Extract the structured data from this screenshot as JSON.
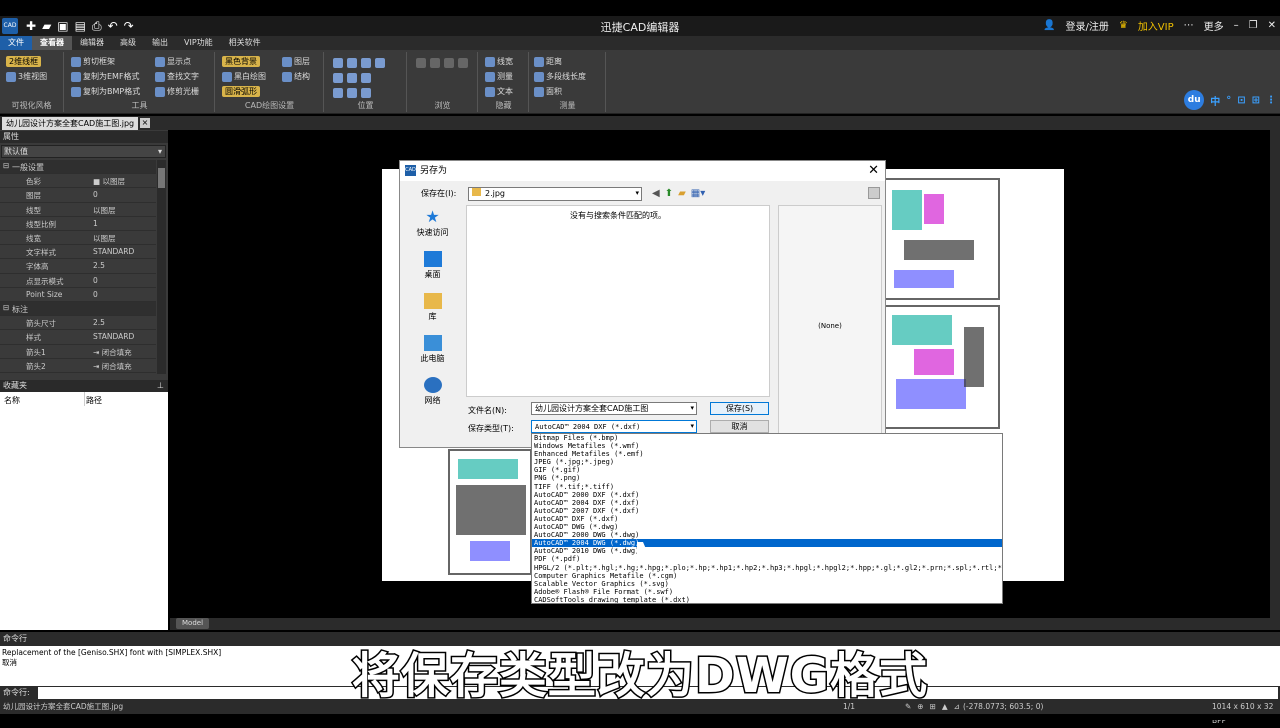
{
  "window": {
    "title": "迅捷CAD编辑器",
    "login": "登录/注册",
    "vip": "加入VIP",
    "more": "更多",
    "logo": "CAD"
  },
  "menu": [
    "文件",
    "查看器",
    "编辑器",
    "高级",
    "输出",
    "VIP功能",
    "相关软件"
  ],
  "ribbon": {
    "visual_style": {
      "label": "可视化风格",
      "items": [
        "2维线框",
        "3维视图"
      ]
    },
    "tools": {
      "label": "工具",
      "items": [
        "剪切框架",
        "复制为EMF格式",
        "复制为BMP格式",
        "显示点",
        "查找文字",
        "修剪光栅"
      ]
    },
    "cad_settings": {
      "label": "CAD绘图设置",
      "items": [
        "黑色背景",
        "黑白绘图",
        "圆滑弧形",
        "图层",
        "结构"
      ]
    },
    "position": {
      "label": "位置"
    },
    "browse": {
      "label": "浏览"
    },
    "hide": {
      "label": "隐藏",
      "items": [
        "线宽",
        "测量",
        "文本"
      ]
    },
    "measure": {
      "label": "测量",
      "items": [
        "距离",
        "多段线长度",
        "面积"
      ]
    },
    "du_icons": [
      "du",
      "中",
      "°",
      "⊡",
      "⊞",
      "⋮"
    ]
  },
  "doc_tab": {
    "name": "幼儿园设计方案全套CAD施工图.jpg",
    "close": "×"
  },
  "properties": {
    "header": "属性",
    "pin": "📌",
    "combo": "默认值",
    "rows": [
      {
        "cat": true,
        "key": "一般设置"
      },
      {
        "key": "色彩",
        "val": "■ 以图层"
      },
      {
        "key": "图层",
        "val": "0"
      },
      {
        "key": "线型",
        "val": "以图层"
      },
      {
        "key": "线型比例",
        "val": "1"
      },
      {
        "key": "线宽",
        "val": "以图层"
      },
      {
        "key": "文字样式",
        "val": "STANDARD"
      },
      {
        "key": "字体高",
        "val": "2.5"
      },
      {
        "key": "点显示模式",
        "val": "0"
      },
      {
        "key": "Point Size",
        "val": "0"
      },
      {
        "cat": true,
        "key": "标注"
      },
      {
        "key": "箭头尺寸",
        "val": "2.5"
      },
      {
        "key": "样式",
        "val": "STANDARD"
      },
      {
        "key": "箭头1",
        "val": "⇥ 闭合填充"
      },
      {
        "key": "箭头2",
        "val": "⇥ 闭合填充"
      }
    ]
  },
  "favorites": {
    "header": "收藏夹",
    "col_name": "名称",
    "col_path": "路径"
  },
  "model_tab": "Model",
  "command": {
    "header": "命令行",
    "lines": [
      "Replacement of the [Geniso.SHX] font with [SIMPLEX.SHX]",
      "取消"
    ],
    "prompt": "命令行:"
  },
  "status": {
    "file": "幼儿园设计方案全套CAD施工图.jpg",
    "page": "1/1",
    "coords": "(-278.0773; 603.5; 0)",
    "size": "1014 x 610 x 32 BPP"
  },
  "subtitle": "将保存类型改为DWG格式",
  "dialog": {
    "title": "另存为",
    "icon": "CAD",
    "close": "✕",
    "save_in_label": "保存在(I):",
    "save_in_value": "2.jpg",
    "empty_msg": "没有与搜索条件匹配的项。",
    "places": [
      "快速访问",
      "桌面",
      "库",
      "此电脑",
      "网络"
    ],
    "filename_label": "文件名(N):",
    "filename_value": "幼儿园设计方案全套CAD施工图",
    "filetype_label": "保存类型(T):",
    "filetype_value": "AutoCAD™ 2004 DXF (*.dxf)",
    "save_btn": "保存(S)",
    "cancel_btn": "取消",
    "preview": "(None)"
  },
  "filetype_options": [
    "Bitmap Files (*.bmp)",
    "Windows Metafiles (*.wmf)",
    "Enhanced Metafiles (*.emf)",
    "JPEG (*.jpg;*.jpeg)",
    "GIF (*.gif)",
    "PNG (*.png)",
    "TIFF (*.tif;*.tiff)",
    "AutoCAD™ 2000 DXF (*.dxf)",
    "AutoCAD™ 2004 DXF (*.dxf)",
    "AutoCAD™ 2007 DXF (*.dxf)",
    "AutoCAD™ DXF (*.dxf)",
    "AutoCAD™ DWG (*.dwg)",
    "AutoCAD™ 2000 DWG (*.dwg)",
    "AutoCAD™ 2004 DWG (*.dwg)",
    "AutoCAD™ 2010 DWG (*.dwg)",
    "PDF (*.pdf)",
    "HPGL/2 (*.plt;*.hgl;*.hg;*.hpg;*.plo;*.hp;*.hp1;*.hp2;*.hp3;*.hpgl;*.hpgl2;*.hpp;*.gl;*.gl2;*.prn;*.spl;*.rtl;*.pcl)",
    "Computer Graphics Metafile (*.cgm)",
    "Scalable Vector Graphics (*.svg)",
    "Adobe® Flash® File Format (*.swf)",
    "CADSoftTools drawing template (*.dxt)"
  ],
  "selected_option_index": 13,
  "colors": {
    "accent": "#1e5fa8",
    "selection": "#0066cc",
    "ribbon_bg": "#3a3a3a",
    "vip": "#f0c000"
  }
}
